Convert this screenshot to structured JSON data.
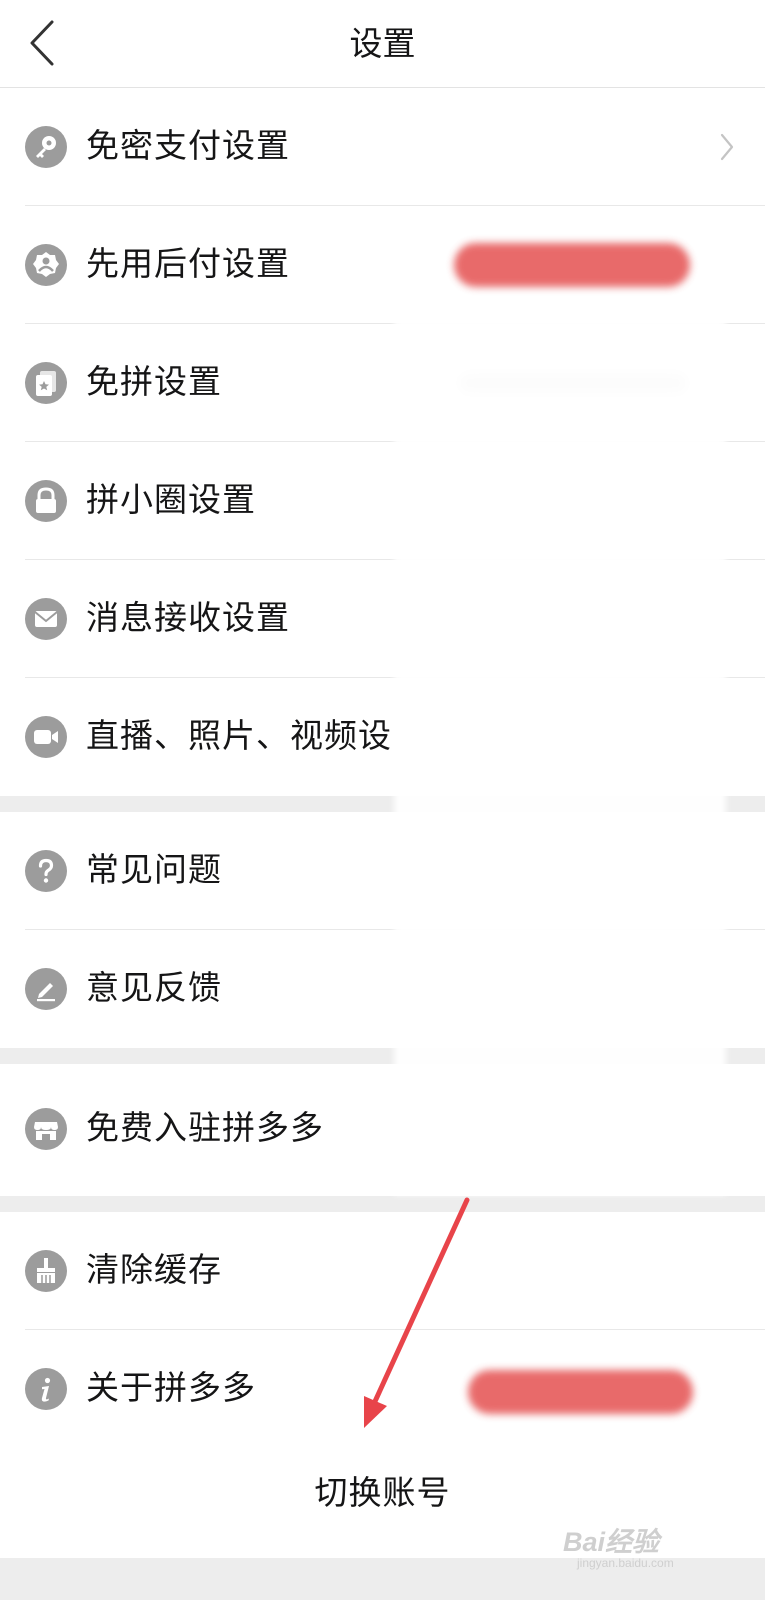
{
  "header": {
    "title": "设置"
  },
  "groups": [
    {
      "items": [
        {
          "icon": "key-icon",
          "label": "免密支付设置",
          "chevron": true
        },
        {
          "icon": "badge-person-icon",
          "label": "先用后付设置"
        },
        {
          "icon": "card-star-icon",
          "label": "免拼设置"
        },
        {
          "icon": "lock-icon",
          "label": "拼小圈设置"
        },
        {
          "icon": "mail-icon",
          "label": "消息接收设置"
        },
        {
          "icon": "video-camera-icon",
          "label": "直播、照片、视频设"
        }
      ]
    },
    {
      "items": [
        {
          "icon": "question-icon",
          "label": "常见问题"
        },
        {
          "icon": "pencil-icon",
          "label": "意见反馈"
        }
      ]
    },
    {
      "items": [
        {
          "icon": "store-icon",
          "label": "免费入驻拼多多"
        }
      ]
    },
    {
      "items": [
        {
          "icon": "broom-icon",
          "label": "清除缓存"
        },
        {
          "icon": "info-icon",
          "label": "关于拼多多"
        }
      ]
    }
  ],
  "switch_account": {
    "label": "切换账号"
  },
  "watermark": {
    "main": "Bai经验",
    "sub": "jingyan.baidu.com"
  },
  "colors": {
    "icon_bg": "#9c9c9c",
    "separator": "#ededed",
    "annotation_arrow": "#e8444a",
    "redacted_pill": "#e65a5a"
  }
}
